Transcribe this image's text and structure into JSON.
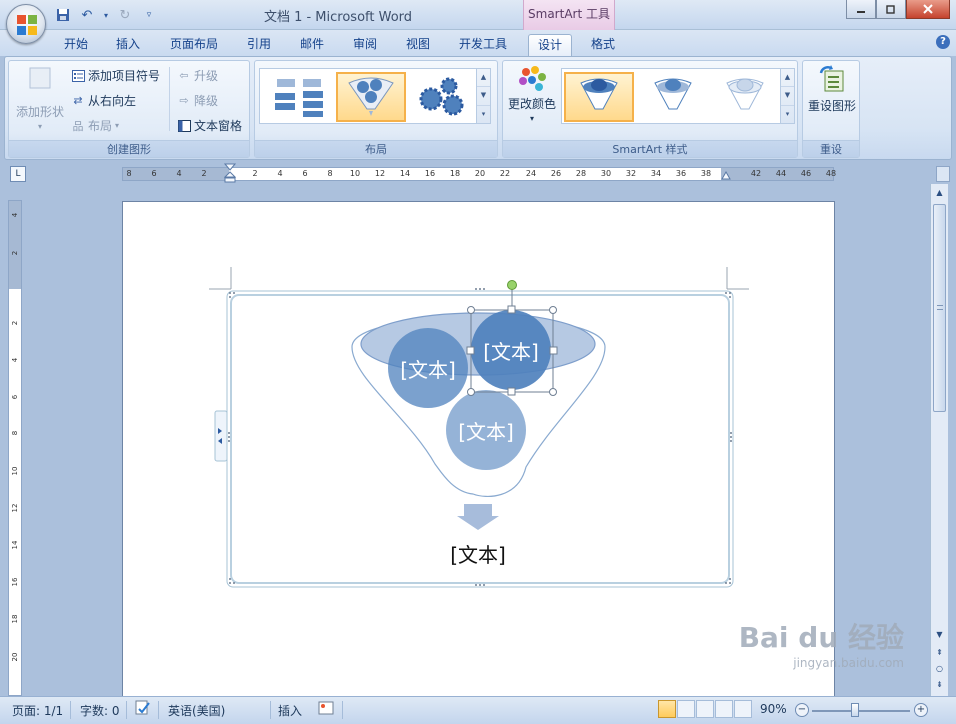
{
  "window": {
    "title": "文档 1 - Microsoft Word",
    "contextual_tab_group": "SmartArt 工具"
  },
  "tabs": [
    {
      "label": "开始",
      "active": false
    },
    {
      "label": "插入",
      "active": false
    },
    {
      "label": "页面布局",
      "active": false
    },
    {
      "label": "引用",
      "active": false
    },
    {
      "label": "邮件",
      "active": false
    },
    {
      "label": "审阅",
      "active": false
    },
    {
      "label": "视图",
      "active": false
    },
    {
      "label": "开发工具",
      "active": false
    },
    {
      "label": "设计",
      "active": true
    },
    {
      "label": "格式",
      "active": false
    }
  ],
  "ribbon": {
    "create_graphic": {
      "label": "创建图形",
      "add_shape": "添加形状",
      "add_bullet": "添加项目符号",
      "right_to_left": "从右向左",
      "layout": "布局",
      "promote": "升级",
      "demote": "降级",
      "text_pane": "文本窗格"
    },
    "layouts": {
      "label": "布局"
    },
    "smartart_styles": {
      "label": "SmartArt 样式",
      "change_colors": "更改颜色"
    },
    "reset": {
      "label": "重设",
      "reset_graphic": "重设图形"
    }
  },
  "ruler": {
    "horizontal_ticks": [
      "8",
      "6",
      "4",
      "2",
      "2",
      "4",
      "6",
      "8",
      "10",
      "12",
      "14",
      "16",
      "18",
      "20",
      "22",
      "24",
      "26",
      "28",
      "30",
      "32",
      "34",
      "36",
      "38",
      "42",
      "44",
      "46",
      "48"
    ],
    "vertical_ticks": [
      "4",
      "2",
      "2",
      "4",
      "6",
      "8",
      "10",
      "12",
      "14",
      "16",
      "18",
      "20"
    ]
  },
  "smartart": {
    "circles": [
      "[文本]",
      "[文本]",
      "[文本]"
    ],
    "result_text": "[文本]"
  },
  "statusbar": {
    "page": "页面: 1/1",
    "words": "字数: 0",
    "language": "英语(美国)",
    "mode": "插入",
    "zoom": "90%"
  },
  "watermark": {
    "brand": "Bai du 经验",
    "url": "jingyan.baidu.com"
  },
  "colors": {
    "accent_blue": "#4f81bd",
    "ribbon_bg": "#dbe6f4",
    "workspace": "#abc0dc",
    "gallery_selected": "#f5b14a"
  }
}
